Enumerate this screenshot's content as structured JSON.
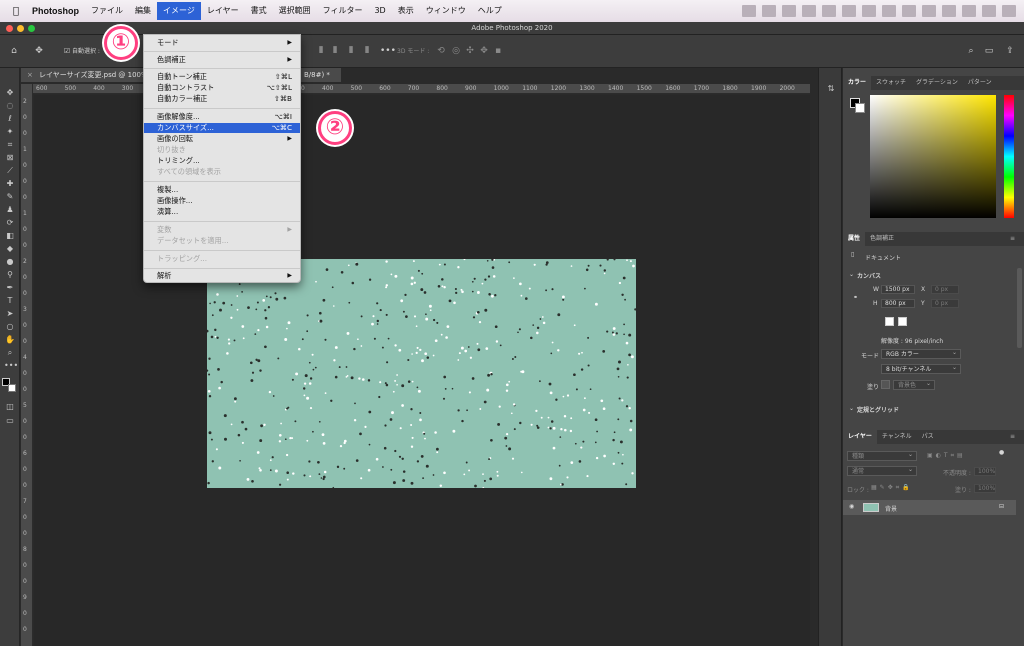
{
  "menubar": {
    "app_name": "Photoshop",
    "items": [
      "ファイル",
      "編集",
      "イメージ",
      "レイヤー",
      "書式",
      "選択範囲",
      "フィルター",
      "3D",
      "表示",
      "ウィンドウ",
      "ヘルプ"
    ],
    "active_item": "イメージ"
  },
  "window": {
    "title": "Adobe Photoshop 2020"
  },
  "options_bar": {
    "auto_select_label": "自動選択 :",
    "mode_3d_label": "3D モード :"
  },
  "document": {
    "tab_label": "レイヤーサイズ変更.psd @ 100% (背景, RGB/8#) *",
    "tab_label_visible_left": "レイヤーサイズ変更.psd @ 100%",
    "tab_label_visible_right": "B/8#) *",
    "ruler_h": [
      "600",
      "500",
      "400",
      "300",
      "200",
      "100",
      "0",
      "100",
      "200",
      "300",
      "400",
      "500",
      "600",
      "700",
      "800",
      "900",
      "1000",
      "1100",
      "1200",
      "1300",
      "1400",
      "1500",
      "1600",
      "1700",
      "1800",
      "1900",
      "2000"
    ],
    "ruler_v": [
      "2",
      "0",
      "0",
      "1",
      "0",
      "0",
      "0",
      "1",
      "0",
      "0",
      "2",
      "0",
      "0",
      "3",
      "0",
      "0",
      "4",
      "0",
      "0",
      "5",
      "0",
      "0",
      "6",
      "0",
      "0",
      "7",
      "0",
      "0",
      "8",
      "0",
      "0",
      "9",
      "0",
      "0"
    ],
    "canvas_color": "#8fc2b2"
  },
  "image_menu": {
    "items": [
      {
        "label": "モード",
        "arrow": true
      },
      {
        "label": "色調補正",
        "arrow": true
      },
      {
        "label": "自動トーン補正",
        "shortcut": "⇧⌘L"
      },
      {
        "label": "自動コントラスト",
        "shortcut": "⌥⇧⌘L"
      },
      {
        "label": "自動カラー補正",
        "shortcut": "⇧⌘B"
      },
      {
        "label": "画像解像度...",
        "shortcut": "⌥⌘I"
      },
      {
        "label": "カンバスサイズ...",
        "shortcut": "⌥⌘C",
        "highlighted": true
      },
      {
        "label": "画像の回転",
        "arrow": true
      },
      {
        "label": "切り抜き",
        "disabled": true
      },
      {
        "label": "トリミング..."
      },
      {
        "label": "すべての領域を表示",
        "disabled": true
      },
      {
        "label": "複製..."
      },
      {
        "label": "画像操作..."
      },
      {
        "label": "演算..."
      },
      {
        "label": "変数",
        "arrow": true,
        "disabled": true
      },
      {
        "label": "データセットを適用...",
        "disabled": true
      },
      {
        "label": "トラッピング...",
        "disabled": true
      },
      {
        "label": "解析",
        "arrow": true
      }
    ]
  },
  "badges": {
    "step1": "①",
    "step2": "②"
  },
  "panels": {
    "color_tabs": [
      "カラー",
      "スウォッチ",
      "グラデーション",
      "パターン"
    ],
    "props_tabs": [
      "属性",
      "色調補正"
    ],
    "doc_label": "ドキュメント",
    "canvas_section": "カンバス",
    "w_label": "W",
    "w_value": "1500 px",
    "h_label": "H",
    "h_value": "800 px",
    "x_label": "X",
    "x_value": "0 px",
    "y_label": "Y",
    "y_value": "0 px",
    "resolution": "解像度 : 96 pixel/inch",
    "mode_label": "モード",
    "mode_value": "RGB カラー",
    "depth_value": "8 bit/チャンネル",
    "fill_label": "塗り",
    "fill_value": "背景色",
    "guides_section": "定規とグリッド",
    "layers_tabs": [
      "レイヤー",
      "チャンネル",
      "パス"
    ],
    "kind_label": "種類",
    "blend_mode": "通常",
    "opacity_label": "不透明度 :",
    "opacity_value": "100%",
    "lock_label": "ロック :",
    "fill2_label": "塗り :",
    "fill2_value": "100%",
    "layer_name": "背景"
  },
  "colors": {
    "menu_highlight": "#2d62d6",
    "badge": "#ff3f80",
    "canvas": "#8fc2b2"
  }
}
